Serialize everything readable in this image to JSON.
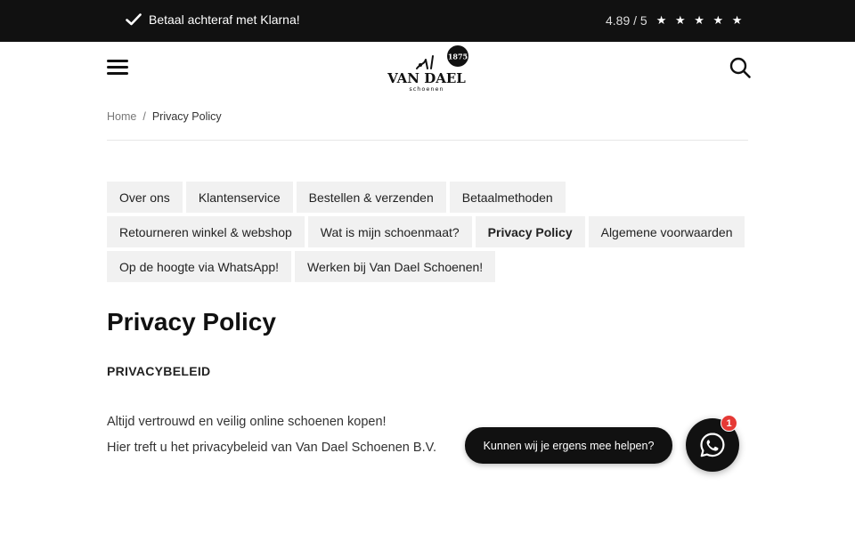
{
  "topbar": {
    "promo_icon": "check-icon",
    "promo_text": "Betaal achteraf met Klarna!",
    "rating_score": "4.89 / 5",
    "rating_stars": "★ ★ ★ ★ ★"
  },
  "header": {
    "menu_icon": "hamburger-menu-icon",
    "logo_brand": "VAN DAEL",
    "logo_sub": "schoenen",
    "logo_year": "1875",
    "search_icon": "search-icon"
  },
  "breadcrumb": {
    "home": "Home",
    "separator": "/",
    "current": "Privacy Policy"
  },
  "tabs": [
    {
      "label": "Over ons",
      "active": false
    },
    {
      "label": "Klantenservice",
      "active": false
    },
    {
      "label": "Bestellen & verzenden",
      "active": false
    },
    {
      "label": "Betaalmethoden",
      "active": false
    },
    {
      "label": "Retourneren winkel & webshop",
      "active": false
    },
    {
      "label": "Wat is mijn schoenmaat?",
      "active": false
    },
    {
      "label": "Privacy Policy",
      "active": true
    },
    {
      "label": "Algemene voorwaarden",
      "active": false
    },
    {
      "label": "Op de hoogte via WhatsApp!",
      "active": false
    },
    {
      "label": "Werken bij Van Dael Schoenen!",
      "active": false
    }
  ],
  "content": {
    "title": "Privacy Policy",
    "section_heading": "PRIVACYBELEID",
    "paragraph_1": "Altijd vertrouwd en veilig online schoenen kopen!",
    "paragraph_2": "Hier treft u het privacybeleid van Van Dael Schoenen B.V."
  },
  "chat": {
    "bubble_text": "Kunnen wij je ergens mee helpen?",
    "button_icon": "whatsapp-icon",
    "badge_count": "1"
  },
  "colors": {
    "topbar_bg": "#111111",
    "tab_bg": "#f1f1f1",
    "badge": "#e53935"
  }
}
